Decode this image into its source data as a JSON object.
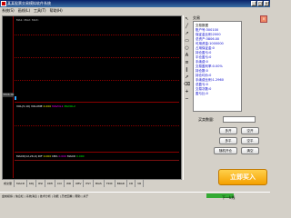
{
  "window": {
    "title": "某某股票交易模拟软件系统",
    "minimize": "_",
    "maximize": "□",
    "close": "×"
  },
  "menu": [
    "系统(S)",
    "画线(L)",
    "工具(T)",
    "帮助(H)"
  ],
  "chart": {
    "header": "MA1: MA2: MA3:",
    "price_box": "3806.00",
    "vol_label": {
      "text": "VOL(5,10) VOLUME",
      "a": "4.000",
      "b": "MAVOL1",
      "c": "MAVOL2"
    },
    "macd_label": {
      "text": "MACD(12,26,9) DIF",
      "a": "0.000",
      "b": "DEA",
      "c": "0.000",
      "d": "MACD",
      "e": "0.000"
    },
    "axis_ticks": [
      "3806",
      "3800",
      "3790",
      "3780"
    ]
  },
  "tabs": [
    "成交量",
    "MACD",
    "KDJ",
    "RSI",
    "DMI",
    "CCI",
    "WR",
    "OBV",
    "PSY",
    "BIAS",
    "TRIX",
    "BRAR",
    "CR",
    "VR",
    "EMV",
    "ASI",
    "ROC",
    "MTM",
    "VWAP"
  ],
  "status": "盘前模拟 | 信息栏 | 系统消息 | 技术分析 | 功能 | 历史回看 | 帮助 | 关于",
  "panel": {
    "section": "交易",
    "close_btn": "×",
    "info_lines": [
      "交易数据",
      "账户号:300100",
      "保证金比例:2000",
      "总资产:3806.00",
      "可用资金:1000000",
      "占用保证金:0",
      "持仓盈亏:0",
      "平仓盈亏:0",
      "手续费:0",
      "交易盈利率:0.00%",
      "持仓数:0",
      "持仓均价:0",
      "手续费比例:1.2960",
      "总盈亏:0",
      "交易次数:0",
      "盈亏比:0"
    ],
    "qty_label": "买卖数量:",
    "buttons": [
      "多开",
      "空开",
      "多平",
      "空平",
      "随机开仓",
      "清空"
    ],
    "big_buy": "立即买入",
    "next_step": "下一k线"
  },
  "toolstrip_icons": [
    "cursor-icon",
    "line-icon",
    "ray-icon",
    "rect-icon",
    "ellipse-icon",
    "text-icon",
    "fib-icon",
    "channel-icon",
    "arrow-icon",
    "eraser-icon",
    "zoom-in-icon",
    "zoom-out-icon"
  ]
}
